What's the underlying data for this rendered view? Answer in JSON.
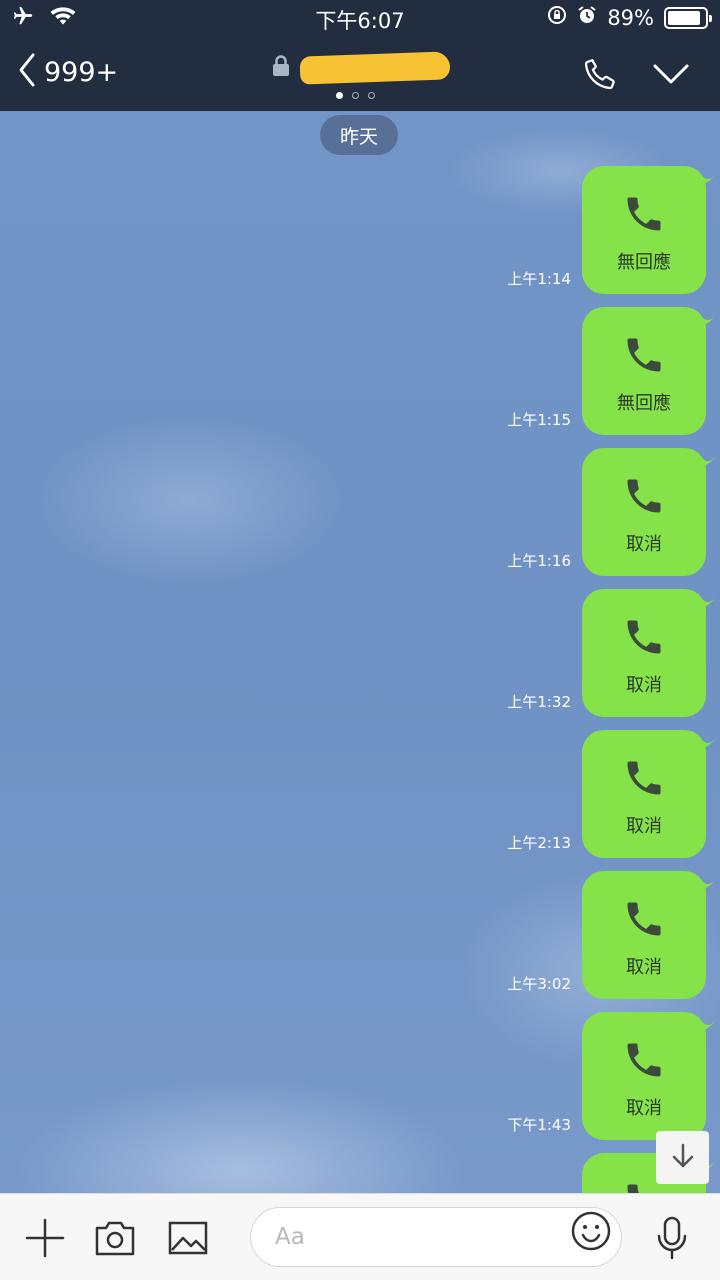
{
  "status_bar": {
    "time": "下午6:07",
    "battery_text": "89%",
    "battery_level": 0.89,
    "icons": [
      "airplane-icon",
      "wifi-icon",
      "orientation-lock-icon",
      "alarm-icon",
      "battery-icon"
    ]
  },
  "header": {
    "back_count": "999+",
    "title_redacted": true,
    "page_dots": 3,
    "active_page": 0,
    "icons": [
      "chevron-left-icon",
      "lock-icon",
      "phone-icon",
      "chevron-down-icon"
    ]
  },
  "chat": {
    "date_separator": "昨天",
    "messages": [
      {
        "label": "無回應",
        "time": "上午1:14"
      },
      {
        "label": "無回應",
        "time": "上午1:15"
      },
      {
        "label": "取消",
        "time": "上午1:16"
      },
      {
        "label": "取消",
        "time": "上午1:32"
      },
      {
        "label": "取消",
        "time": "上午2:13"
      },
      {
        "label": "取消",
        "time": "上午3:02"
      },
      {
        "label": "取消",
        "time": "下午1:43"
      }
    ],
    "bubble_color": "#85e249"
  },
  "input_bar": {
    "placeholder": "Aa",
    "icons": [
      "plus-icon",
      "camera-icon",
      "image-icon",
      "emoji-icon",
      "microphone-icon"
    ]
  },
  "colors": {
    "header_bg": "#222d3f",
    "chat_bg": "#6f92c4"
  }
}
